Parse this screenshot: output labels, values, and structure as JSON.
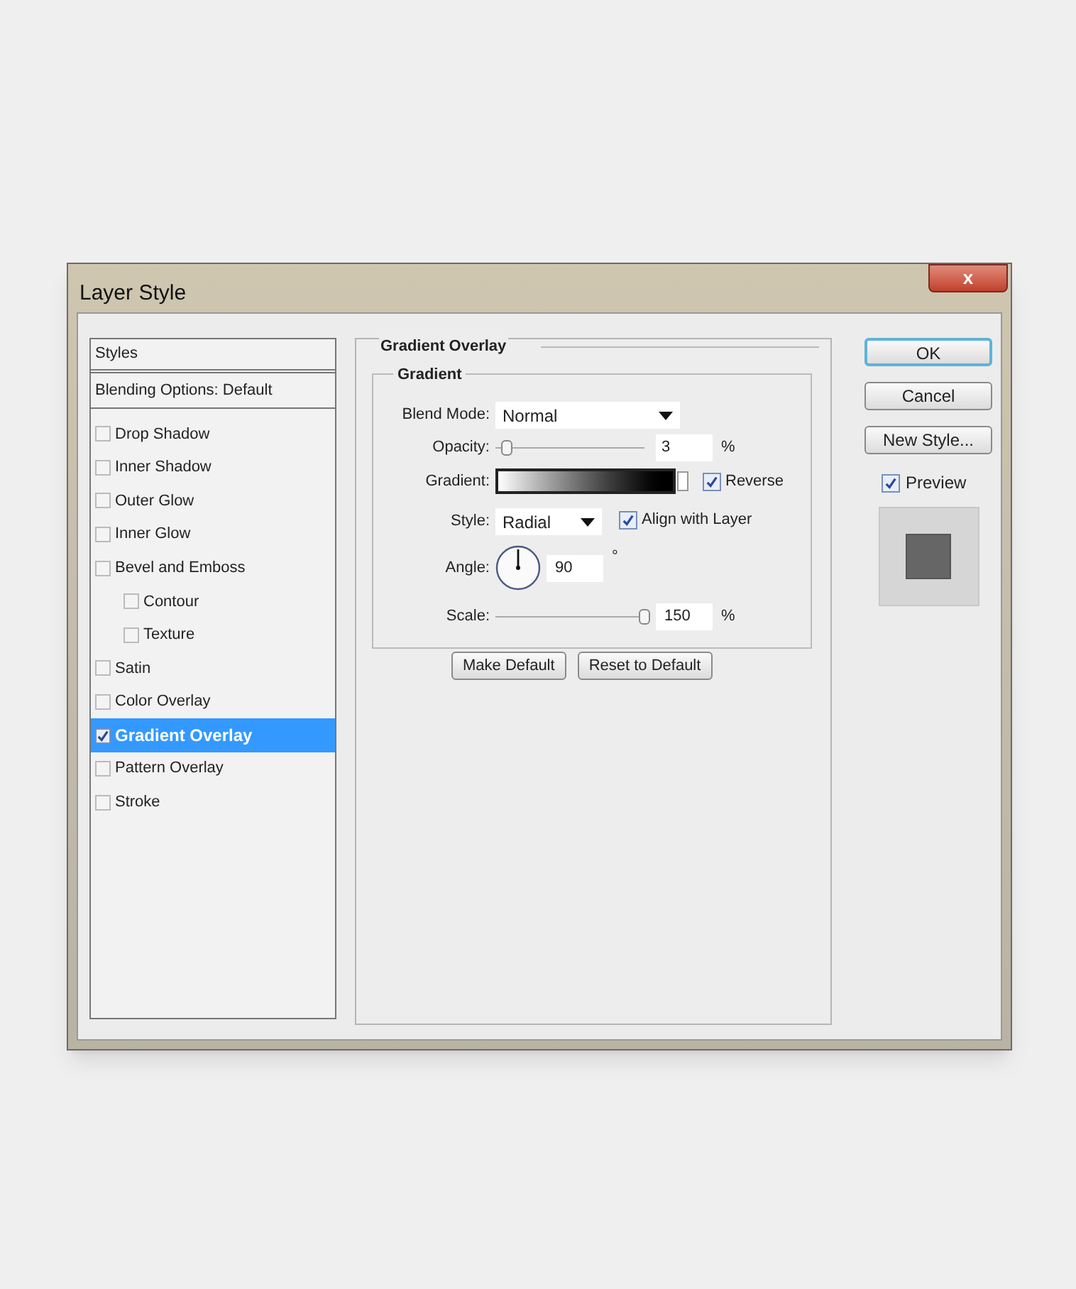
{
  "window": {
    "title": "Layer Style",
    "close": "x"
  },
  "styles_list": [
    {
      "kind": "header",
      "label": "Styles"
    },
    {
      "kind": "options",
      "label": "Blending Options: Default"
    },
    {
      "kind": "effect",
      "label": "Drop Shadow",
      "checked": false,
      "selected": false
    },
    {
      "kind": "effect",
      "label": "Inner Shadow",
      "checked": false,
      "selected": false
    },
    {
      "kind": "effect",
      "label": "Outer Glow",
      "checked": false,
      "selected": false
    },
    {
      "kind": "effect",
      "label": "Inner Glow",
      "checked": false,
      "selected": false
    },
    {
      "kind": "effect",
      "label": "Bevel and Emboss",
      "checked": false,
      "selected": false,
      "children": [
        {
          "kind": "effect",
          "label": "Contour",
          "checked": false,
          "selected": false
        },
        {
          "kind": "effect",
          "label": "Texture",
          "checked": false,
          "selected": false
        }
      ]
    },
    {
      "kind": "effect",
      "label": "Satin",
      "checked": false,
      "selected": false
    },
    {
      "kind": "effect",
      "label": "Color Overlay",
      "checked": false,
      "selected": false
    },
    {
      "kind": "effect",
      "label": "Gradient Overlay",
      "checked": true,
      "selected": true
    },
    {
      "kind": "effect",
      "label": "Pattern Overlay",
      "checked": false,
      "selected": false
    },
    {
      "kind": "effect",
      "label": "Stroke",
      "checked": false,
      "selected": false
    }
  ],
  "panel": {
    "title": "Gradient Overlay",
    "group_title": "Gradient",
    "blend_mode": {
      "label": "Blend Mode:",
      "value": "Normal"
    },
    "opacity": {
      "label": "Opacity:",
      "level": 0.08,
      "value": "3",
      "unit": "%"
    },
    "gradient": {
      "label": "Gradient:",
      "reverse": {
        "label": "Reverse",
        "checked": true
      }
    },
    "style": {
      "label": "Style:",
      "value": "Radial",
      "align": {
        "label": "Align with Layer",
        "checked": true
      }
    },
    "angle": {
      "label": "Angle:",
      "value": "90",
      "unit": "°"
    },
    "scale": {
      "label": "Scale:",
      "level": 1,
      "value": "150",
      "unit": "%"
    },
    "buttons": [
      "Make Default",
      "Reset to Default"
    ]
  },
  "side_buttons": [
    {
      "label": "OK",
      "default": true
    },
    {
      "label": "Cancel",
      "default": false
    },
    {
      "label": "New Style...",
      "default": false
    }
  ],
  "preview": {
    "label": "Preview",
    "checked": true
  }
}
